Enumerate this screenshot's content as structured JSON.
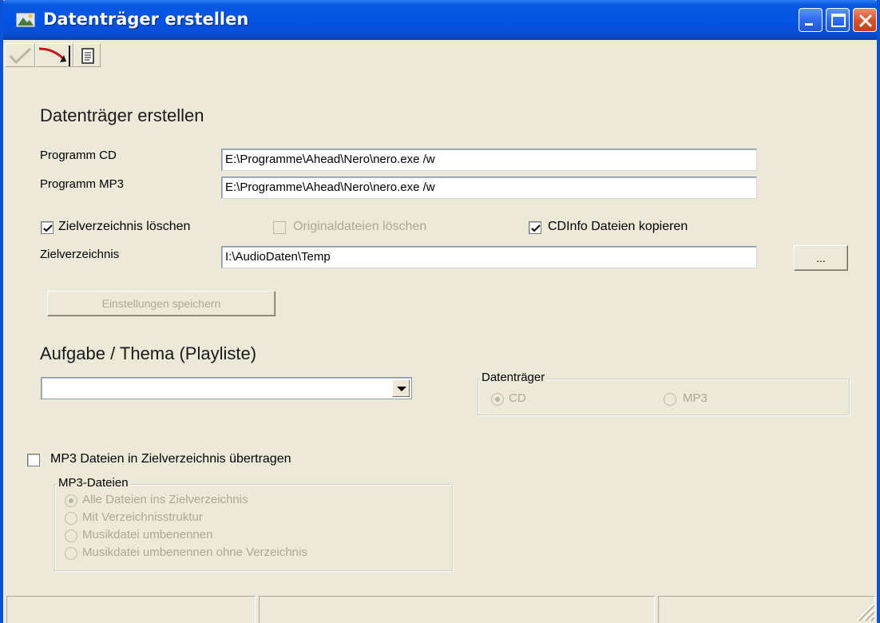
{
  "window": {
    "title": "Datenträger erstellen"
  },
  "toolbar": {
    "items": [
      {
        "name": "confirm",
        "icon": "checkmark-icon",
        "enabled": false
      },
      {
        "name": "run",
        "icon": "arrow-run-icon",
        "enabled": true
      },
      {
        "name": "notes",
        "icon": "document-icon",
        "enabled": true
      }
    ]
  },
  "main": {
    "heading": "Datenträger erstellen",
    "program_cd": {
      "label": "Programm CD",
      "value": "E:\\Programme\\Ahead\\Nero\\nero.exe /w"
    },
    "program_mp3": {
      "label": "Programm MP3",
      "value": "E:\\Programme\\Ahead\\Nero\\nero.exe /w"
    },
    "options": {
      "delete_target": {
        "label": "Zielverzeichnis löschen",
        "checked": true,
        "enabled": true
      },
      "delete_originals": {
        "label": "Originaldateien löschen",
        "checked": false,
        "enabled": false
      },
      "copy_cdinfo": {
        "label": "CDInfo Dateien kopieren",
        "checked": true,
        "enabled": true
      }
    },
    "target_dir": {
      "label": "Zielverzeichnis",
      "value": "I:\\AudioDaten\\Temp",
      "browse_label": "..."
    },
    "save_button": {
      "label": "Einstellungen speichern",
      "enabled": false
    },
    "task_heading": "Aufgabe / Thema (Playliste)",
    "task_combo": {
      "value": ""
    },
    "medium": {
      "legend": "Datenträger",
      "options": [
        {
          "label": "CD",
          "selected": true
        },
        {
          "label": "MP3",
          "selected": false
        }
      ]
    },
    "transfer_mp3": {
      "label": "MP3 Dateien in Zielverzeichnis übertragen",
      "checked": false
    },
    "mp3_files": {
      "legend": "MP3-Dateien",
      "options": [
        {
          "label": "Alle Dateien ins Zielverzeichnis",
          "selected": true
        },
        {
          "label": "Mit Verzeichnisstruktur",
          "selected": false
        },
        {
          "label": "Musikdatei umbenennen",
          "selected": false
        },
        {
          "label": "Musikdatei umbenennen ohne Verzeichnis",
          "selected": false
        }
      ]
    }
  },
  "colors": {
    "titlebar": "#0454e6",
    "window_bg": "#ece9d8",
    "disabled_text": "#aca899"
  }
}
